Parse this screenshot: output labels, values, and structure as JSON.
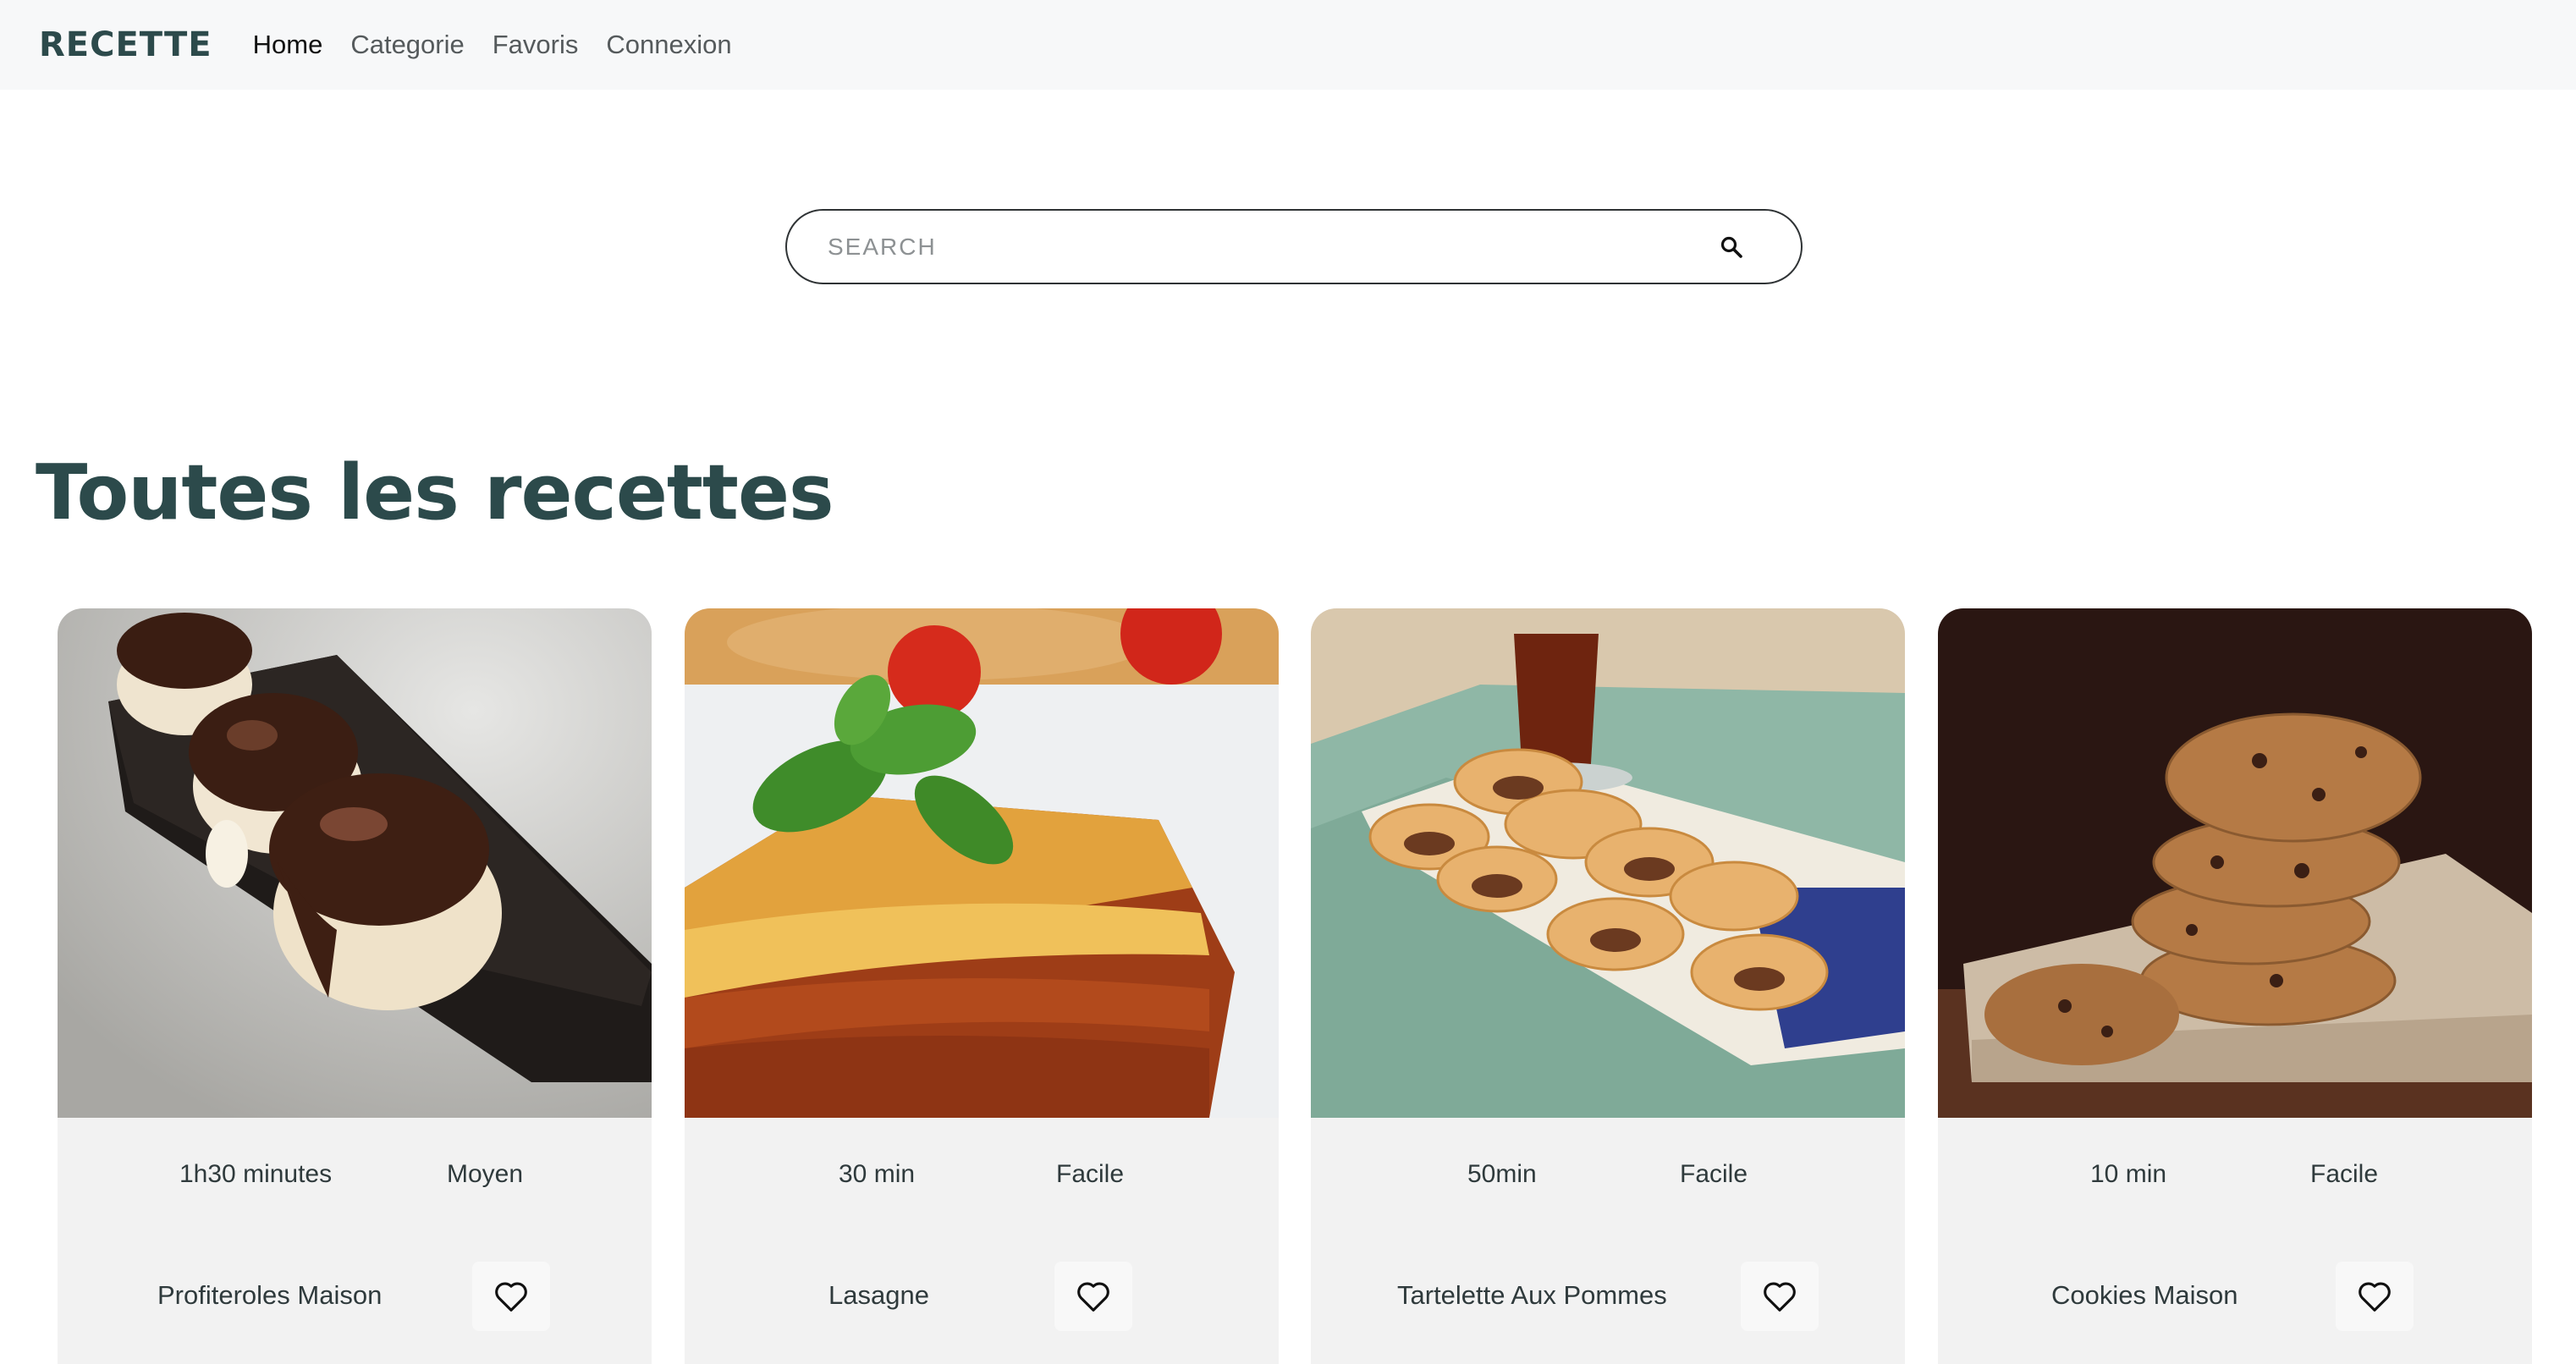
{
  "navbar": {
    "brand": "RECETTE",
    "links": [
      {
        "label": "Home",
        "active": true
      },
      {
        "label": "Categorie",
        "active": false
      },
      {
        "label": "Favoris",
        "active": false
      },
      {
        "label": "Connexion",
        "active": false
      }
    ]
  },
  "search": {
    "placeholder": "SEARCH",
    "value": "",
    "icon": "search-icon"
  },
  "main": {
    "heading": "Toutes les recettes"
  },
  "recipes": [
    {
      "time": "1h30 minutes",
      "difficulty": "Moyen",
      "title": "Profiteroles Maison",
      "favorite_icon": "heart-icon"
    },
    {
      "time": "30 min",
      "difficulty": "Facile",
      "title": "Lasagne",
      "favorite_icon": "heart-icon"
    },
    {
      "time": "50min",
      "difficulty": "Facile",
      "title": "Tartelette Aux Pommes",
      "favorite_icon": "heart-icon"
    },
    {
      "time": "10 min",
      "difficulty": "Facile",
      "title": "Cookies Maison",
      "favorite_icon": "heart-icon"
    }
  ],
  "colors": {
    "brand": "#2c4a4b",
    "navbar_bg": "#f7f8f9",
    "card_bg": "#f2f2f2"
  }
}
